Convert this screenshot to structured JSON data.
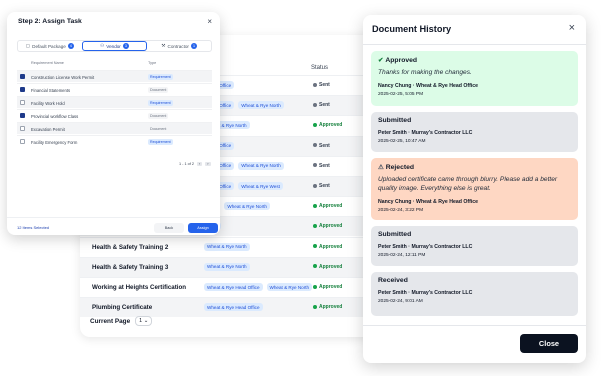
{
  "background_table": {
    "status_header": "Status",
    "rows": [
      {
        "name": "",
        "chips": [
          "Head Office"
        ],
        "status": "Sent",
        "status_kind": "sent"
      },
      {
        "name": "",
        "chips": [
          "Head Office",
          "Wheat & Rye North"
        ],
        "status": "Sent",
        "status_kind": "sent"
      },
      {
        "name": "",
        "chips": [
          "Wheat & Rye North"
        ],
        "status": "Approved",
        "status_kind": "approved"
      },
      {
        "name": "",
        "chips": [
          "Head Office"
        ],
        "status": "Sent",
        "status_kind": "sent"
      },
      {
        "name": "",
        "chips": [
          "Head Office",
          "Wheat & Rye North"
        ],
        "status": "Sent",
        "status_kind": "sent"
      },
      {
        "name": "",
        "chips": [
          "Head Office",
          "Wheat & Rye West"
        ],
        "status": "Sent",
        "status_kind": "sent"
      },
      {
        "name": "",
        "chips": [
          "West",
          "Wheat & Rye North"
        ],
        "status": "Approved",
        "status_kind": "approved"
      },
      {
        "name": "",
        "chips": [
          "North"
        ],
        "status": "Approved",
        "status_kind": "approved"
      },
      {
        "name": "Health & Safety Training 2",
        "chips": [
          "Wheat & Rye North"
        ],
        "status": "Approved",
        "status_kind": "approved"
      },
      {
        "name": "Health & Safety Training 3",
        "chips": [
          "Wheat & Rye North"
        ],
        "status": "Approved",
        "status_kind": "approved"
      },
      {
        "name": "Working at Heights Certification",
        "chips": [
          "Wheat & Rye Head Office",
          "Wheat & Rye North"
        ],
        "status": "Approved",
        "status_kind": "approved"
      },
      {
        "name": "Plumbing Certificate",
        "chips": [
          "Wheat & Rye Head Office"
        ],
        "status": "Approved",
        "status_kind": "approved"
      }
    ],
    "pager_label": "Current Page",
    "pager_value": "1 ⌄"
  },
  "assign_modal": {
    "title": "Step 2: Assign Task",
    "close_glyph": "×",
    "tabs": [
      {
        "label": "Default Package",
        "count": "4",
        "active": false,
        "icon": "box-icon"
      },
      {
        "label": "Vendor",
        "count": "3",
        "active": true,
        "icon": "user-icon"
      },
      {
        "label": "Contractor",
        "count": "1",
        "active": false,
        "icon": "wrench-icon"
      }
    ],
    "columns": {
      "name": "Requirement Name",
      "type": "Type"
    },
    "rows": [
      {
        "name": "Construction License Work Permit",
        "type": "Requirement",
        "type_kind": "req",
        "checked": true
      },
      {
        "name": "Financial Statements",
        "type": "Document",
        "type_kind": "doc",
        "checked": true
      },
      {
        "name": "Facility Work Hold",
        "type": "Requirement",
        "type_kind": "req",
        "checked": false
      },
      {
        "name": "Provincial workflow Class",
        "type": "Document",
        "type_kind": "doc",
        "checked": true
      },
      {
        "name": "Excavation Permit",
        "type": "Document",
        "type_kind": "doc",
        "checked": false
      },
      {
        "name": "Facility Emergency Form",
        "type": "Requirement",
        "type_kind": "req",
        "checked": false
      }
    ],
    "pager_text": "1 - 1 of 2",
    "pager_prev": "‹",
    "pager_next": "›",
    "selected_text": "12 Items Selected",
    "back_label": "Back",
    "assign_label": "Assign"
  },
  "history": {
    "title": "Document History",
    "close_glyph": "×",
    "entries": [
      {
        "status": "Approved",
        "color": "green",
        "icon": "check-icon",
        "message": "Thanks for making the changes.",
        "person": "Nancy Chung  ·  Wheat & Rye Head Office",
        "time": "2025-02-25, 5:05 PM"
      },
      {
        "status": "Submitted",
        "color": "gray",
        "icon": "",
        "message": "",
        "person": "Peter Smith  ·  Murray's Contractor LLC",
        "time": "2025-02-25, 10:47 AM"
      },
      {
        "status": "Rejected",
        "color": "red",
        "icon": "warning-icon",
        "message": "Uploaded certificate came through blurry. Please add a better quality image. Everything else is great.",
        "person": "Nancy Chung  ·  Wheat & Rye Head Office",
        "time": "2025-02-24, 3:22 PM"
      },
      {
        "status": "Submitted",
        "color": "gray",
        "icon": "",
        "message": "",
        "person": "Peter Smith  ·  Murray's Contractor LLC",
        "time": "2025-02-24, 12:11 PM"
      },
      {
        "status": "Received",
        "color": "gray",
        "icon": "",
        "message": "",
        "person": "Peter Smith  ·  Murray's Contractor LLC",
        "time": "2025-02-24, 9:01 AM"
      }
    ],
    "close_button_label": "Close"
  }
}
